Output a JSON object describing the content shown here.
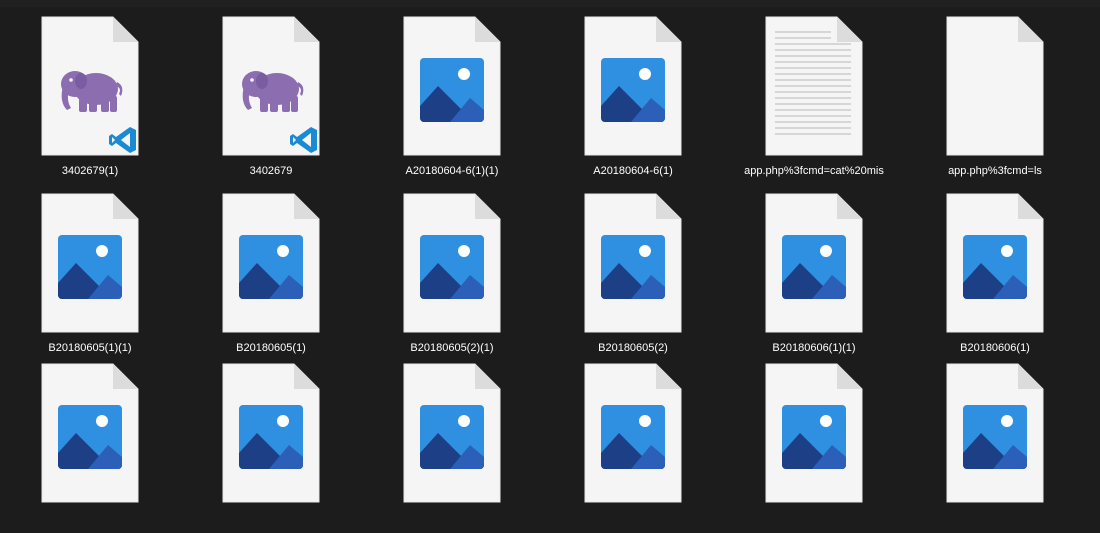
{
  "window": {
    "background": "#1c1c1c"
  },
  "files": [
    {
      "name": "3402679(1)",
      "icon": "php-elephant-icon",
      "badge": "vscode-icon"
    },
    {
      "name": "3402679",
      "icon": "php-elephant-icon",
      "badge": "vscode-icon"
    },
    {
      "name": "A20180604-6(1)(1)",
      "icon": "image-file-icon"
    },
    {
      "name": "A20180604-6(1)",
      "icon": "image-file-icon"
    },
    {
      "name": "app.php%3fcmd=cat%20mis",
      "icon": "text-file-icon"
    },
    {
      "name": "app.php%3fcmd=ls",
      "icon": "blank-file-icon"
    },
    {
      "name": "B20180605(1)(1)",
      "icon": "image-file-icon"
    },
    {
      "name": "B20180605(1)",
      "icon": "image-file-icon"
    },
    {
      "name": "B20180605(2)(1)",
      "icon": "image-file-icon"
    },
    {
      "name": "B20180605(2)",
      "icon": "image-file-icon"
    },
    {
      "name": "B20180606(1)(1)",
      "icon": "image-file-icon"
    },
    {
      "name": "B20180606(1)",
      "icon": "image-file-icon"
    },
    {
      "name": "",
      "icon": "image-file-icon"
    },
    {
      "name": "",
      "icon": "image-file-icon"
    },
    {
      "name": "",
      "icon": "image-file-icon"
    },
    {
      "name": "",
      "icon": "image-file-icon"
    },
    {
      "name": "",
      "icon": "image-file-icon"
    },
    {
      "name": "",
      "icon": "image-file-icon"
    }
  ],
  "colors": {
    "page": "#f5f5f5",
    "fold": "#dcdcdc",
    "elephant": "#8b6db0",
    "vscode": "#1a8ad4",
    "image_bg": "#2f8fe0",
    "image_mountain_dark": "#1c3f86",
    "image_mountain_mid": "#2b5fb8",
    "image_sun": "#ffffff",
    "text_lines": "#b8b8b8",
    "label_text": "#ffffff"
  }
}
